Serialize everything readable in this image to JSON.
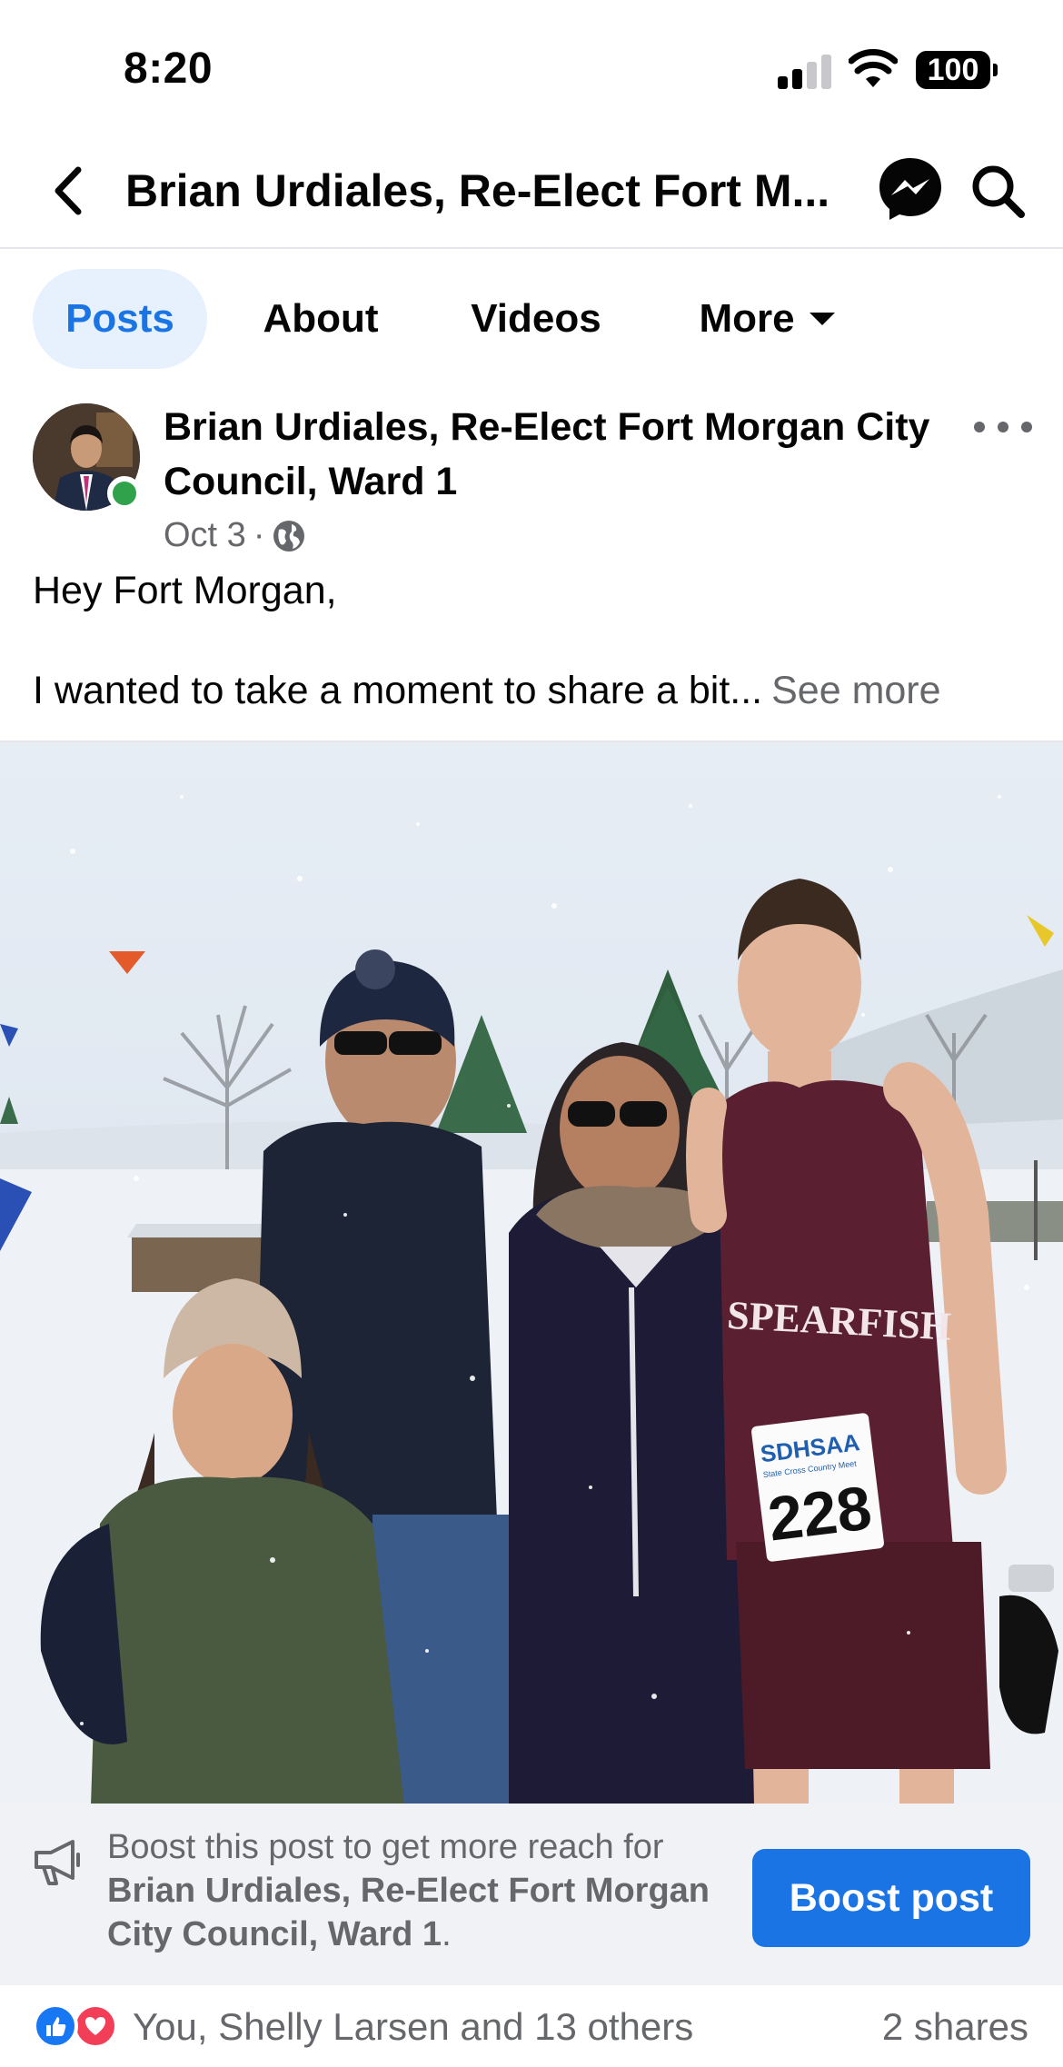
{
  "status_bar": {
    "time": "8:20",
    "battery": "100",
    "icons": [
      "signal-icon",
      "wifi-icon",
      "battery-icon"
    ]
  },
  "header": {
    "title": "Brian Urdiales, Re-Elect Fort M...",
    "icons": [
      "back-arrow-icon",
      "messenger-icon",
      "search-icon"
    ]
  },
  "tabs": [
    {
      "label": "Posts",
      "active": true
    },
    {
      "label": "About",
      "active": false
    },
    {
      "label": "Videos",
      "active": false
    },
    {
      "label": "More",
      "active": false
    }
  ],
  "post": {
    "author": "Brian Urdiales, Re-Elect Fort Morgan City Council, Ward 1",
    "date": "Oct 3",
    "separator": "·",
    "audience_icon": "globe-icon",
    "text_line1": "Hey Fort Morgan,",
    "text_line2": "I wanted to take a moment to share a bit...",
    "see_more": "See more",
    "photo_text": {
      "jersey": "SPEARFISH",
      "bib_org": "SDHSAA",
      "bib_sub": "State Cross Country Meet",
      "bib_number": "228"
    }
  },
  "boost": {
    "text_prefix": "Boost this post to get more reach for",
    "text_bold": "Brian Urdiales, Re-Elect Fort Morgan City Council, Ward 1",
    "text_suffix": ".",
    "button": "Boost post"
  },
  "reactions": {
    "summary": "You, Shelly Larsen and 13 others",
    "shares": "2 shares",
    "types": [
      "like-icon",
      "love-icon"
    ]
  },
  "colors": {
    "accent": "#1b74e4",
    "tab_active_bg": "#e7f0fd",
    "secondary_text": "#65676b",
    "online": "#31a24c",
    "like": "#1877f2",
    "love": "#f33e58"
  }
}
